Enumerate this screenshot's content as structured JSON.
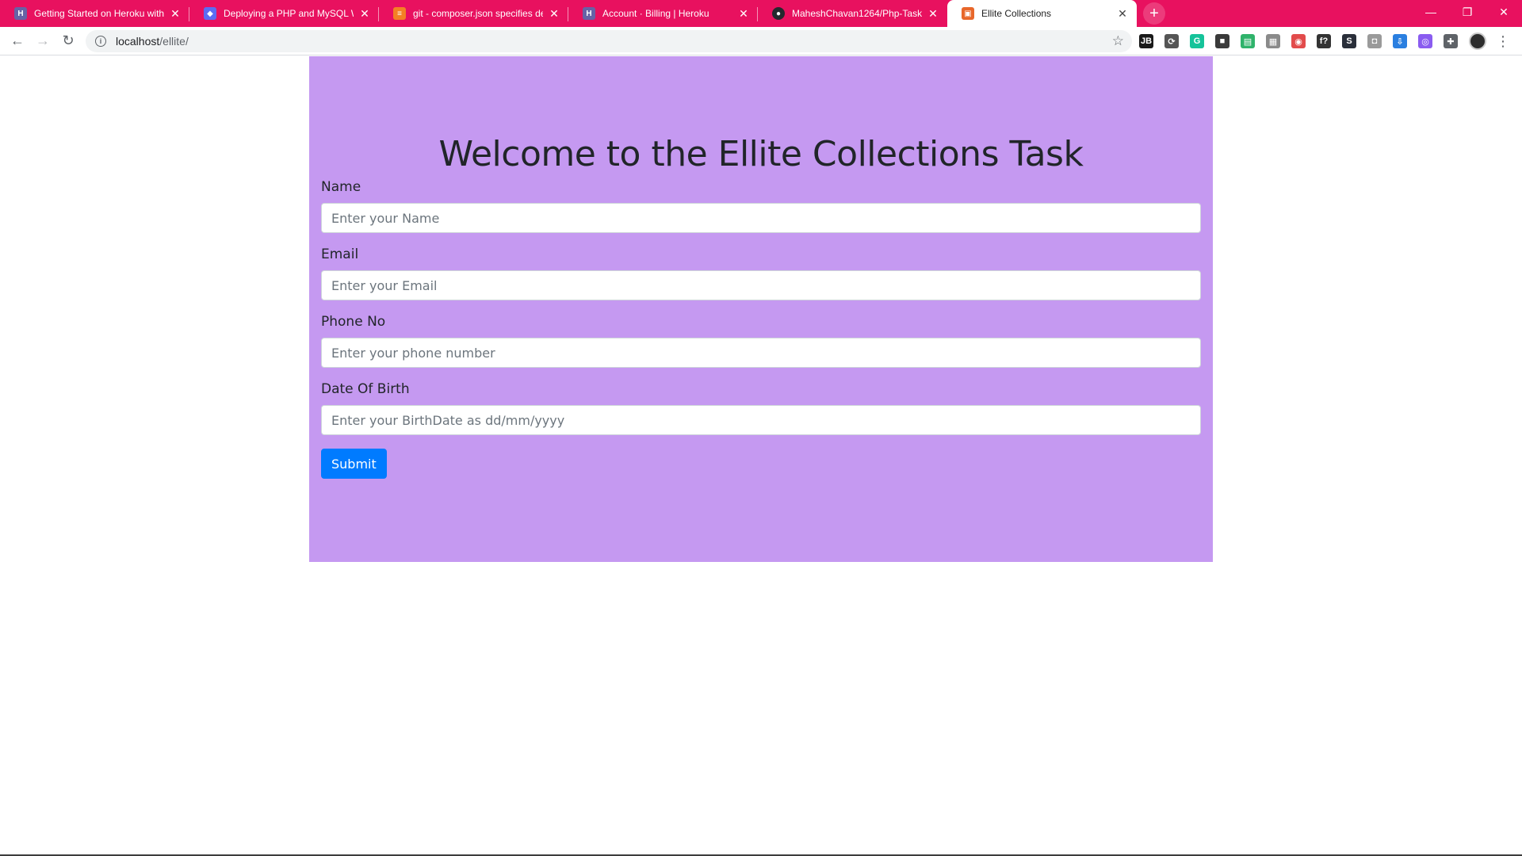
{
  "browser": {
    "tabs": [
      {
        "title": "Getting Started on Heroku with P",
        "favicon": "heroku-icon",
        "favicon_glyph": "H",
        "favicon_color": "#6762a6",
        "active": false
      },
      {
        "title": "Deploying a PHP and MySQL We",
        "favicon": "bird-icon",
        "favicon_glyph": "◆",
        "favicon_color": "#5b6cf2",
        "active": false
      },
      {
        "title": "git - composer.json specifies dep",
        "favicon": "stackoverflow-icon",
        "favicon_glyph": "≡",
        "favicon_color": "#f48024",
        "active": false
      },
      {
        "title": "Account · Billing | Heroku",
        "favicon": "heroku-icon",
        "favicon_glyph": "H",
        "favicon_color": "#6762a6",
        "active": false
      },
      {
        "title": "MaheshChavan1264/Php-Task",
        "favicon": "github-icon",
        "favicon_glyph": "●",
        "favicon_color": "#24292e",
        "active": false
      },
      {
        "title": "Ellite Collections",
        "favicon": "site-icon",
        "favicon_glyph": "▣",
        "favicon_color": "#e8672a",
        "active": true
      }
    ],
    "new_tab_glyph": "+",
    "window_controls": {
      "minimize": "—",
      "restore": "❐",
      "close": "✕"
    },
    "url_host": "localhost",
    "url_path": "/ellite/",
    "accent_color": "#e8115f",
    "extensions": [
      {
        "name": "jetbrains-extension-icon",
        "glyph": "JB",
        "color": "#1a1a1a"
      },
      {
        "name": "sync-extension-icon",
        "glyph": "⟳",
        "color": "#555555"
      },
      {
        "name": "grammarly-extension-icon",
        "glyph": "G",
        "color": "#15c39a"
      },
      {
        "name": "cube-extension-icon",
        "glyph": "■",
        "color": "#3a3a3a"
      },
      {
        "name": "green-extension-icon",
        "glyph": "▤",
        "color": "#2fb36b"
      },
      {
        "name": "gallery-extension-icon",
        "glyph": "▦",
        "color": "#8a8a8a"
      },
      {
        "name": "color-wheel-extension-icon",
        "glyph": "◉",
        "color": "#e24b4b"
      },
      {
        "name": "font-extension-icon",
        "glyph": "f?",
        "color": "#333333"
      },
      {
        "name": "s-extension-icon",
        "glyph": "S",
        "color": "#2a2f3a"
      },
      {
        "name": "camera-extension-icon",
        "glyph": "◘",
        "color": "#9a9a9a"
      },
      {
        "name": "download-extension-icon",
        "glyph": "⇩",
        "color": "#2a7fe0"
      },
      {
        "name": "purple-extension-icon",
        "glyph": "◎",
        "color": "#8a5cf0"
      },
      {
        "name": "puzzle-extension-icon",
        "glyph": "✚",
        "color": "#5f6368"
      }
    ]
  },
  "page": {
    "heading": "Welcome to the Ellite Collections Task",
    "panel_color": "#c599f1",
    "fields": [
      {
        "label": "Name",
        "placeholder": "Enter your Name"
      },
      {
        "label": "Email",
        "placeholder": "Enter your Email"
      },
      {
        "label": "Phone No",
        "placeholder": "Enter your phone number"
      },
      {
        "label": "Date Of Birth",
        "placeholder": "Enter your BirthDate as dd/mm/yyyy"
      }
    ],
    "submit_label": "Submit",
    "button_color": "#007bff"
  }
}
